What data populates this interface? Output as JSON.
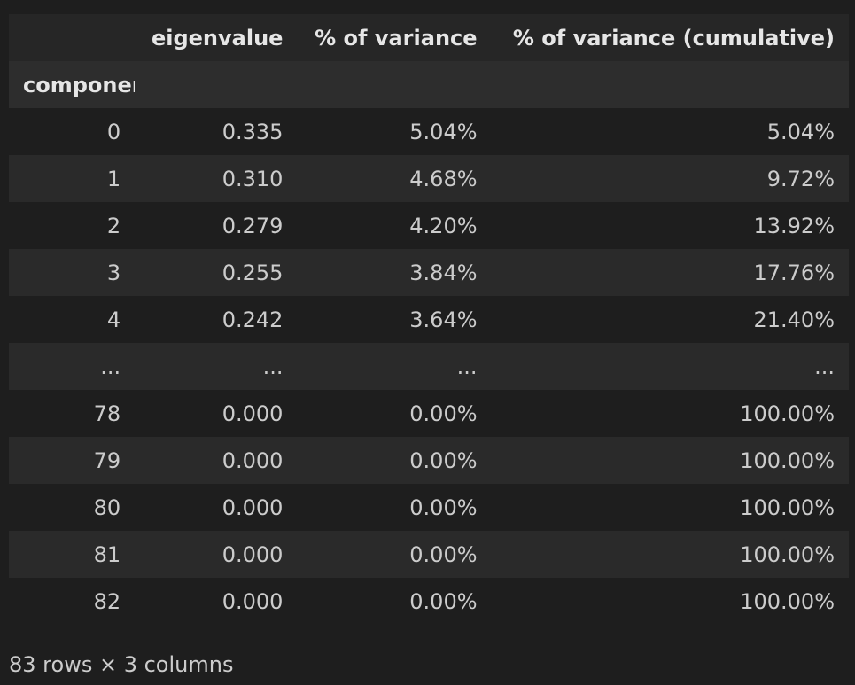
{
  "table": {
    "columns": [
      "",
      "eigenvalue",
      "% of variance",
      "% of variance (cumulative)"
    ],
    "index_name": "component",
    "rows": [
      [
        "0",
        "0.335",
        "5.04%",
        "5.04%"
      ],
      [
        "1",
        "0.310",
        "4.68%",
        "9.72%"
      ],
      [
        "2",
        "0.279",
        "4.20%",
        "13.92%"
      ],
      [
        "3",
        "0.255",
        "3.84%",
        "17.76%"
      ],
      [
        "4",
        "0.242",
        "3.64%",
        "21.40%"
      ],
      [
        "...",
        "...",
        "...",
        "..."
      ],
      [
        "78",
        "0.000",
        "0.00%",
        "100.00%"
      ],
      [
        "79",
        "0.000",
        "0.00%",
        "100.00%"
      ],
      [
        "80",
        "0.000",
        "0.00%",
        "100.00%"
      ],
      [
        "81",
        "0.000",
        "0.00%",
        "100.00%"
      ],
      [
        "82",
        "0.000",
        "0.00%",
        "100.00%"
      ]
    ]
  },
  "footer": "83 rows × 3 columns"
}
